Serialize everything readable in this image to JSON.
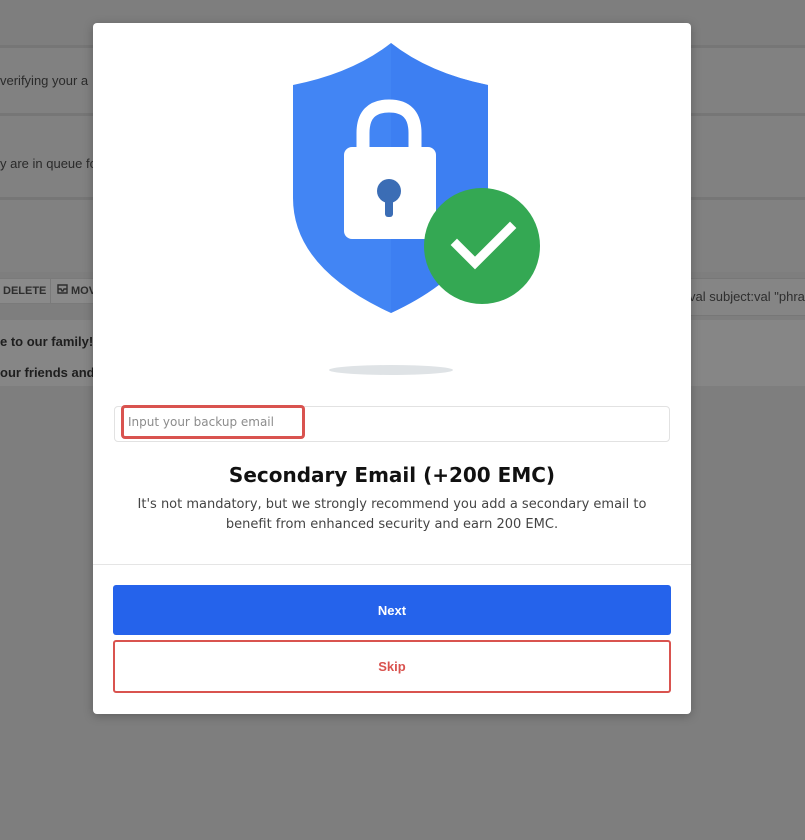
{
  "background": {
    "row1_text": "verifying your a",
    "row2_text": "y are in queue fo",
    "toolbar": {
      "delete_label": "DELETE",
      "move_label": "MOV"
    },
    "search_text": "val subject:val \"phra",
    "list": [
      {
        "text": "e to our family!"
      },
      {
        "text": "our friends and"
      }
    ]
  },
  "modal": {
    "illustration": {
      "shield_color": "#4285f4",
      "check_color": "#34a853",
      "lock_color": "#ffffff",
      "keyhole_color": "#3b6db5"
    },
    "email_input": {
      "placeholder": "Input your backup email",
      "value": ""
    },
    "title": "Secondary Email (+200 EMC)",
    "description": "It's not mandatory, but we strongly recommend you add a secondary email to benefit from enhanced security and earn 200 EMC.",
    "next_label": "Next",
    "skip_label": "Skip"
  },
  "colors": {
    "primary": "#2563eb",
    "danger": "#d9534f",
    "overlay": "#7e7e7e"
  }
}
